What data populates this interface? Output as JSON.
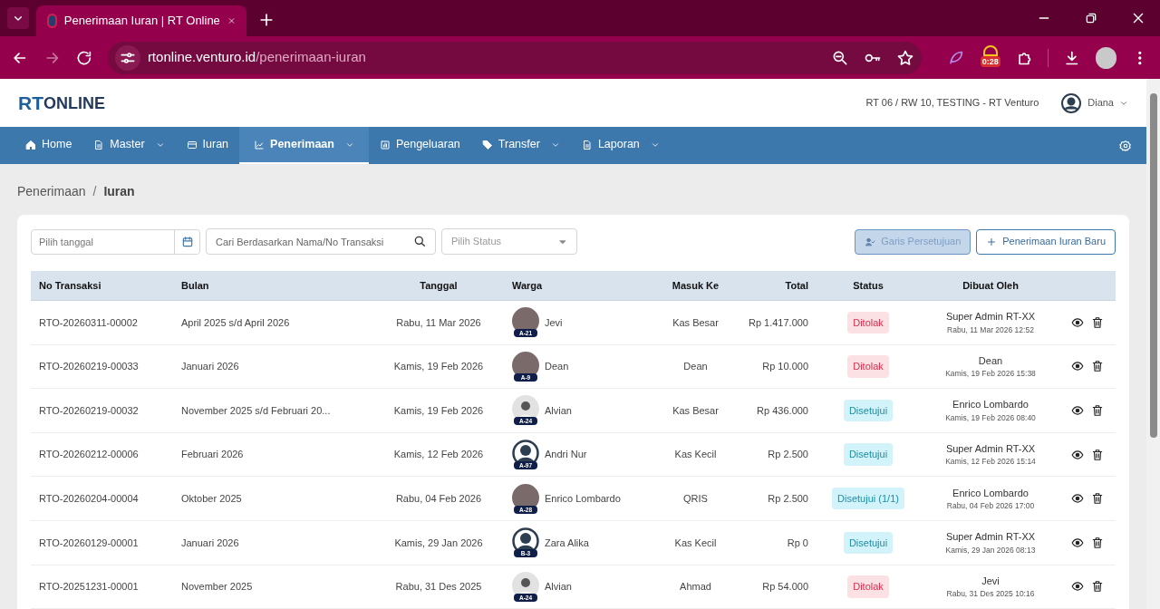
{
  "browser": {
    "tab_title": "Penerimaan Iuran | RT Online",
    "url_host": "rtonline.venturo.id",
    "url_path": "/penerimaan-iuran",
    "extension_badge": "0:28"
  },
  "header": {
    "logo_left": "RT",
    "logo_right": "ONLINE",
    "org": "RT 06 / RW 10, TESTING - RT Venturo",
    "user": "Diana"
  },
  "nav": [
    {
      "label": "Home",
      "kind": "home",
      "dropdown": false,
      "selected": false
    },
    {
      "label": "Master",
      "kind": "file",
      "dropdown": true,
      "selected": false
    },
    {
      "label": "Iuran",
      "kind": "card",
      "dropdown": false,
      "selected": false
    },
    {
      "label": "Penerimaan",
      "kind": "chart",
      "dropdown": true,
      "selected": true
    },
    {
      "label": "Pengeluaran",
      "kind": "bars",
      "dropdown": false,
      "selected": false
    },
    {
      "label": "Transfer",
      "kind": "tag",
      "dropdown": true,
      "selected": false
    },
    {
      "label": "Laporan",
      "kind": "file",
      "dropdown": true,
      "selected": false
    }
  ],
  "breadcrumb": {
    "items": [
      "Penerimaan",
      "Iuran"
    ],
    "separator": "/"
  },
  "filters": {
    "date_placeholder": "Pilih tanggal",
    "search_placeholder": "Cari Berdasarkan Nama/No Transaksi",
    "status_placeholder": "Pilih Status"
  },
  "buttons": {
    "approval": "Garis Persetujuan",
    "new": "Penerimaan Iuran Baru"
  },
  "table": {
    "columns": [
      "No Transaksi",
      "Bulan",
      "Tanggal",
      "Warga",
      "Masuk Ke",
      "Total",
      "Status",
      "Dibuat Oleh"
    ],
    "rows": [
      {
        "no": "RTO-20260311-00002",
        "bulan": "April 2025 s/d April 2026",
        "tanggal": "Rabu, 11 Mar 2026",
        "avatar": {
          "kind": "photo",
          "unit": "A-21"
        },
        "warga": "Jevi",
        "masuk": "Kas Besar",
        "total": "Rp 1.417.000",
        "status": {
          "text": "Ditolak",
          "kind": "rejected"
        },
        "by": "Super Admin RT-XX",
        "by_time": "Rabu, 11 Mar 2026 12:52"
      },
      {
        "no": "RTO-20260219-00033",
        "bulan": "Januari 2026",
        "tanggal": "Kamis, 19 Feb 2026",
        "avatar": {
          "kind": "photo",
          "unit": "A-9"
        },
        "warga": "Dean",
        "masuk": "Dean",
        "total": "Rp 10.000",
        "status": {
          "text": "Ditolak",
          "kind": "rejected"
        },
        "by": "Dean",
        "by_time": "Kamis, 19 Feb 2026 15:38"
      },
      {
        "no": "RTO-20260219-00032",
        "bulan": "November 2025 s/d Februari 20...",
        "tanggal": "Kamis, 19 Feb 2026",
        "avatar": {
          "kind": "default",
          "unit": "A-24"
        },
        "warga": "Alvian",
        "masuk": "Kas Besar",
        "total": "Rp 436.000",
        "status": {
          "text": "Disetujui",
          "kind": "approved"
        },
        "by": "Enrico Lombardo",
        "by_time": "Kamis, 19 Feb 2026 08:40"
      },
      {
        "no": "RTO-20260212-00006",
        "bulan": "Februari 2026",
        "tanggal": "Kamis, 12 Feb 2026",
        "avatar": {
          "kind": "icon",
          "unit": "A-97"
        },
        "warga": "Andri Nur",
        "masuk": "Kas Kecil",
        "total": "Rp 2.500",
        "status": {
          "text": "Disetujui",
          "kind": "approved"
        },
        "by": "Super Admin RT-XX",
        "by_time": "Kamis, 12 Feb 2026 15:14"
      },
      {
        "no": "RTO-20260204-00004",
        "bulan": "Oktober 2025",
        "tanggal": "Rabu, 04 Feb 2026",
        "avatar": {
          "kind": "photo",
          "unit": "A-28"
        },
        "warga": "Enrico Lombardo",
        "masuk": "QRIS",
        "total": "Rp 2.500",
        "status": {
          "text": "Disetujui (1/1)",
          "kind": "approved"
        },
        "by": "Enrico Lombardo",
        "by_time": "Rabu, 04 Feb 2026 17:00"
      },
      {
        "no": "RTO-20260129-00001",
        "bulan": "Januari 2026",
        "tanggal": "Kamis, 29 Jan 2026",
        "avatar": {
          "kind": "icon",
          "unit": "B-3"
        },
        "warga": "Zara Alika",
        "masuk": "Kas Kecil",
        "total": "Rp 0",
        "status": {
          "text": "Disetujui",
          "kind": "approved"
        },
        "by": "Super Admin RT-XX",
        "by_time": "Kamis, 29 Jan 2026 08:13"
      },
      {
        "no": "RTO-20251231-00001",
        "bulan": "November 2025",
        "tanggal": "Rabu, 31 Des 2025",
        "avatar": {
          "kind": "default",
          "unit": "A-24"
        },
        "warga": "Alvian",
        "masuk": "Ahmad",
        "total": "Rp 54.000",
        "status": {
          "text": "Ditolak",
          "kind": "rejected"
        },
        "by": "Jevi",
        "by_time": "Rabu, 31 Des 2025 10:16"
      }
    ]
  }
}
